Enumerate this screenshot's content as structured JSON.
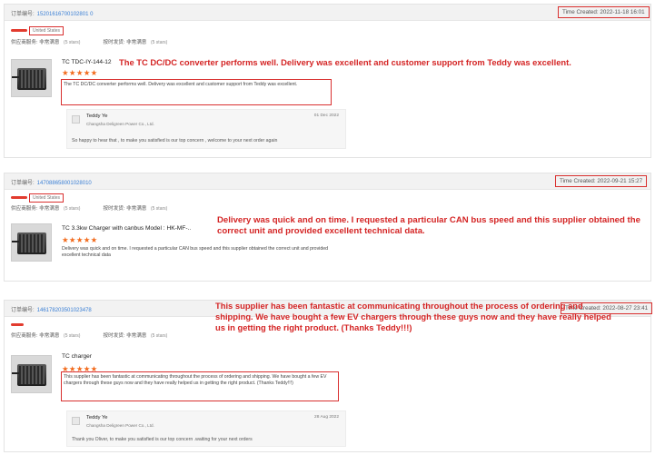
{
  "reviews": [
    {
      "order_label": "订单编号:",
      "order_no": "15201616700102801 0",
      "time_created": "Time Created: 2022-11-18 16:01",
      "country": "United States",
      "service_label": "供应商服务:",
      "service_value": "非常满意",
      "service_stars": "(5 stars)",
      "delivery_label": "按时发货:",
      "delivery_value": "非常满意",
      "delivery_stars": "(5 stars)",
      "product_title": "TC TDC-IY-144-12",
      "stars": "★★★★★",
      "review_text": "The TC DC/DC converter performs well.  Delivery was excellent and customer support from Teddy was excellent.",
      "annotation": "The TC DC/DC converter performs well.  Delivery was excellent and customer support from Teddy was excellent.",
      "reply": {
        "seller": "Teddy Ye",
        "company": "Changsha Deligreen Power Co., Ltd.",
        "date": "01 Dec 2022",
        "text": "So happy to hear that , to make you satisfied is our top concern , welcome to your next order again"
      }
    },
    {
      "order_label": "订单编号:",
      "order_no": "147088658001028010",
      "time_created": "Time Created: 2022-09-21 15:27",
      "country": "United States",
      "service_label": "供应商服务:",
      "service_value": "非常满意",
      "service_stars": "(5 stars)",
      "delivery_label": "按时发货:",
      "delivery_value": "非常满意",
      "delivery_stars": "(5 stars)",
      "product_title": "TC 3.3kw Charger with canbus Model : HK-MF-..",
      "stars": "★★★★★",
      "review_text": "Delivery was quick and on time.  I requested a particular CAN bus speed and this supplier obtained the correct unit and provided excellent technical data",
      "annotation": "Delivery was quick and on time.  I requested a particular CAN bus speed and this supplier obtained the correct unit and provided excellent technical data."
    },
    {
      "order_label": "订单编号:",
      "order_no": "146178203501023478",
      "time_created": "Time Created: 2022-08-27 23:41",
      "country": "",
      "service_label": "供应商服务:",
      "service_value": "非常满意",
      "service_stars": "(5 stars)",
      "delivery_label": "按时发货:",
      "delivery_value": "非常满意",
      "delivery_stars": "(5 stars)",
      "product_title": "TC charger",
      "stars": "★★★★★",
      "review_text": "This supplier has been fantastic at communicating throughout the process of ordering and shipping. We have bought a few EV chargers through these guys now and they have really helped us in getting the right product. (Thanks Teddy!!!)",
      "annotation": "This supplier has been fantastic at communicating throughout the process of ordering and shipping. We have bought a few EV chargers through these guys now and they have really helped us in getting the right product. (Thanks Teddy!!!)",
      "reply": {
        "seller": "Teddy Ye",
        "company": "Changsha Deligreen Power Co., Ltd.",
        "date": "28 Aug 2022",
        "text": "Thank you Oliver, to make you satisfied is our top concern .waiting for your next orders"
      }
    }
  ]
}
